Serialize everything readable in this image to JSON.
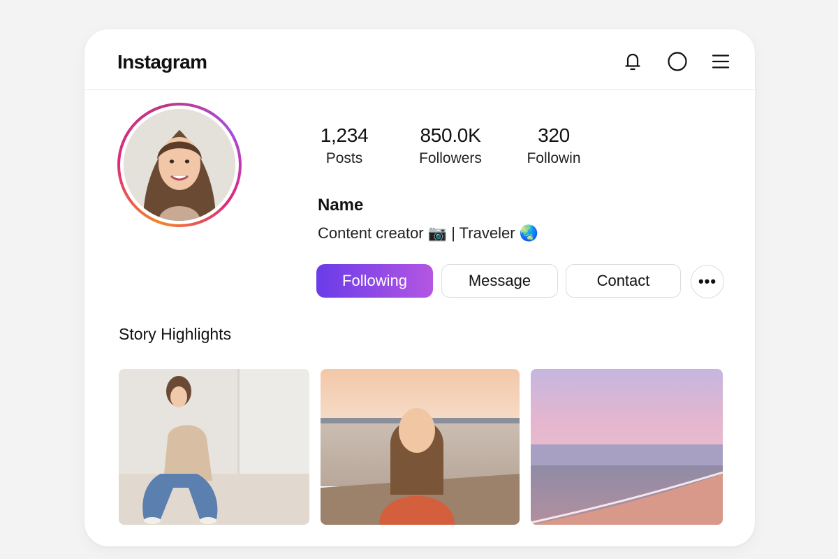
{
  "header": {
    "brand": "Instagram",
    "icons": [
      "bell-icon",
      "circle-icon",
      "menu-icon"
    ]
  },
  "profile": {
    "stats": [
      {
        "value": "1,234",
        "label": "Posts"
      },
      {
        "value": "850.0K",
        "label": "Followers"
      },
      {
        "value": "320",
        "label": "Followin"
      }
    ],
    "name": "Name",
    "bio": "Content creator 📷 | Traveler 🌏"
  },
  "actions": {
    "following": "Following",
    "message": "Message",
    "contact": "Contact",
    "more": "•••"
  },
  "highlights": {
    "title": "Story Highlights"
  },
  "colors": {
    "accent_start": "#6a3ce8",
    "accent_end": "#b456e2",
    "ring_start": "#f58529",
    "ring_end": "#c13584"
  }
}
